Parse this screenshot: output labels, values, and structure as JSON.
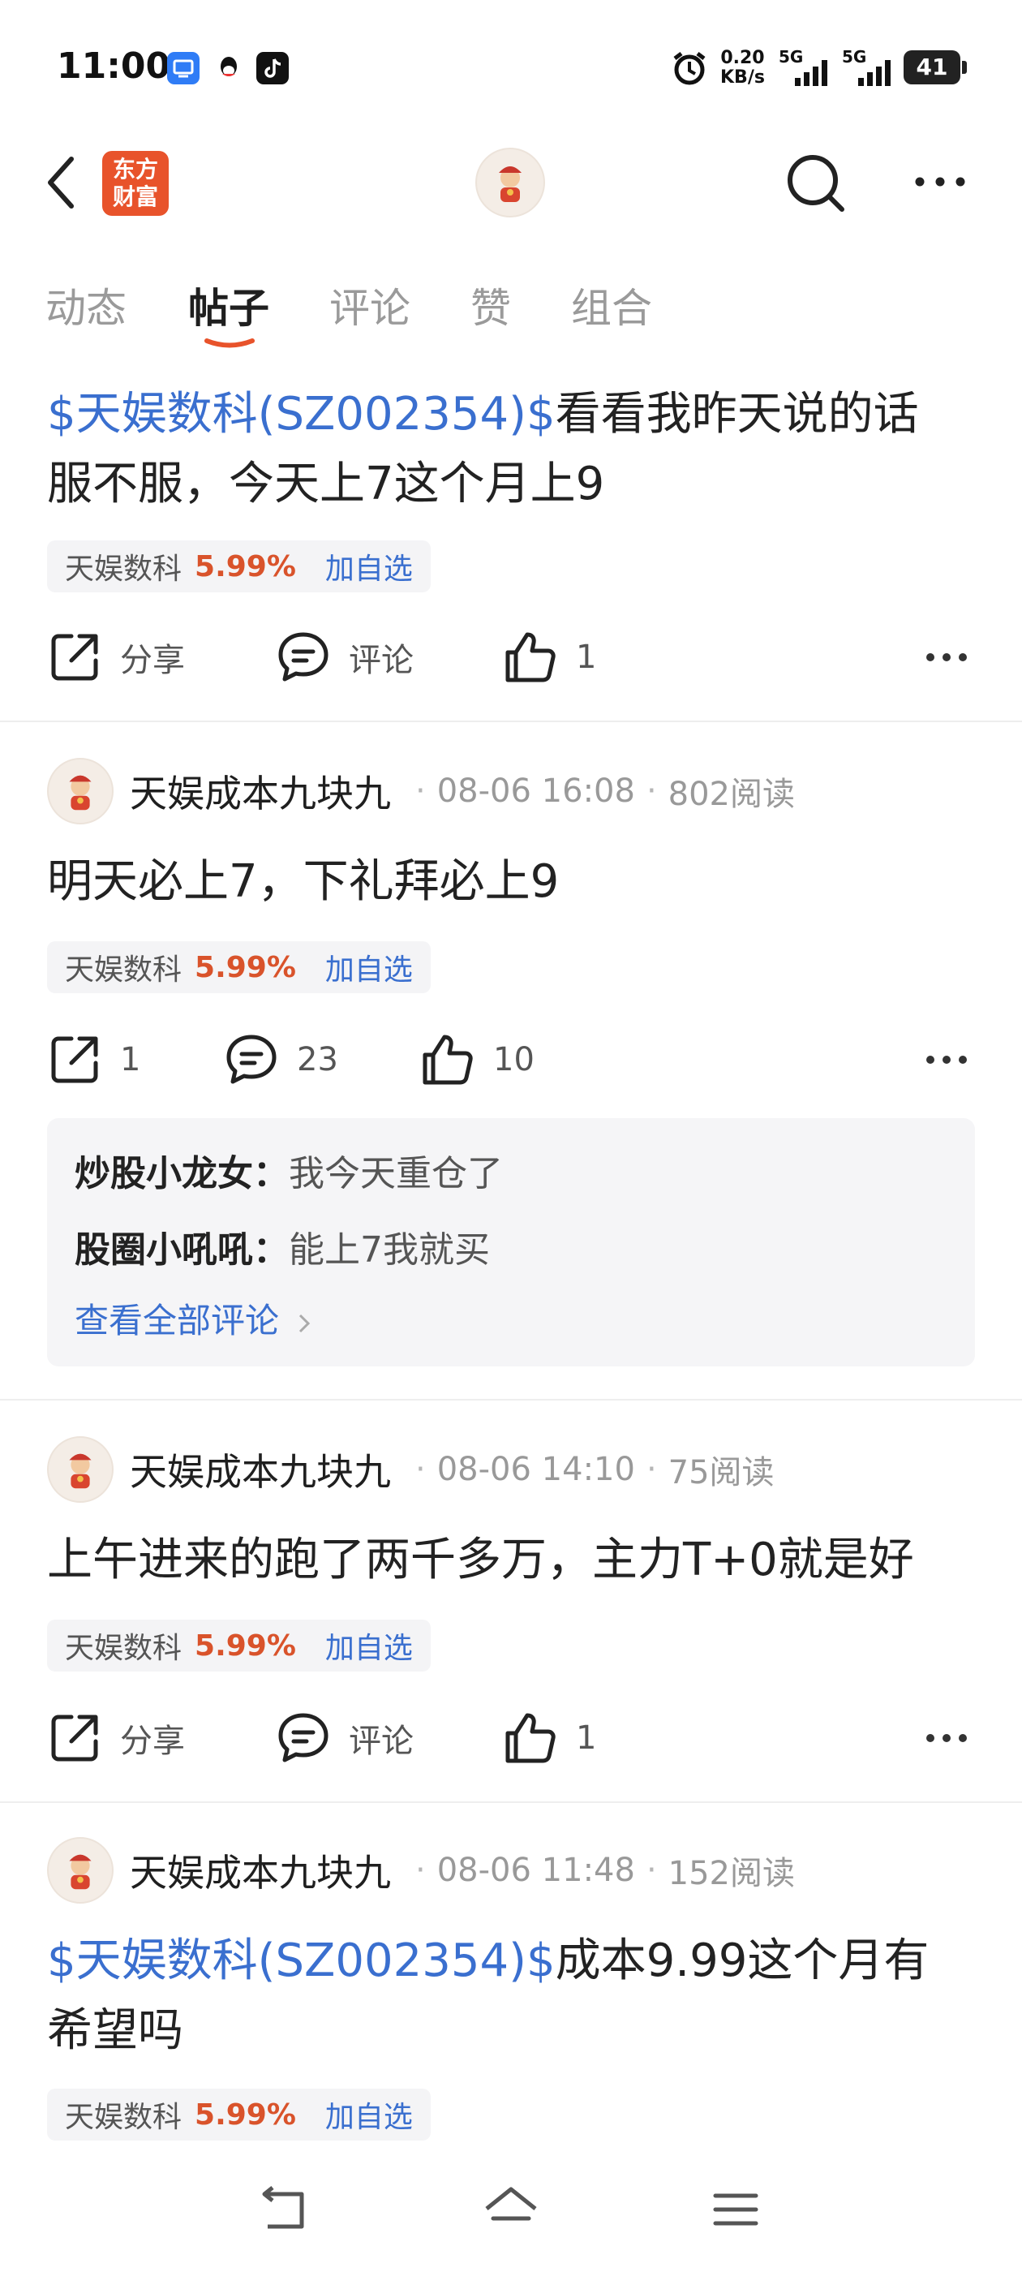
{
  "status_bar": {
    "time": "11:00",
    "net_speed_top": "0.20",
    "net_speed_bottom": "KB/s",
    "sig1": "5G",
    "sig2": "5G",
    "battery": "41"
  },
  "header": {
    "logo_text_1": "东方",
    "logo_text_2": "财富",
    "back_icon": "chevron-left-icon",
    "search_icon": "search-icon",
    "more_icon": "more-horizontal-icon"
  },
  "tabs": [
    {
      "label": "动态"
    },
    {
      "label": "帖子",
      "active": true
    },
    {
      "label": "评论"
    },
    {
      "label": "赞"
    },
    {
      "label": "组合"
    }
  ],
  "posts": [
    {
      "link": "$天娱数科(SZ002354)$",
      "text_line1": "看看我昨天说的话",
      "text_line2": "服不服，今天上7这个月上9",
      "stock": {
        "name": "天娱数科",
        "change": "5.99%",
        "add": "加自选"
      },
      "actions": {
        "share": "分享",
        "comment": "评论",
        "like": "1"
      }
    },
    {
      "author": "天娱成本九块九",
      "date": "08-06 16:08",
      "reads": "802阅读",
      "text": "明天必上7，下礼拜必上9",
      "stock": {
        "name": "天娱数科",
        "change": "5.99%",
        "add": "加自选"
      },
      "actions": {
        "share": "1",
        "comment": "23",
        "like": "10"
      },
      "comments": [
        {
          "user": "炒股小龙女：",
          "text": "我今天重仓了"
        },
        {
          "user": "股圈小吼吼：",
          "text": "能上7我就买"
        }
      ],
      "see_all": "查看全部评论"
    },
    {
      "author": "天娱成本九块九",
      "date": "08-06 14:10",
      "reads": "75阅读",
      "text": "上午进来的跑了两千多万，主力T+0就是好",
      "stock": {
        "name": "天娱数科",
        "change": "5.99%",
        "add": "加自选"
      },
      "actions": {
        "share": "分享",
        "comment": "评论",
        "like": "1"
      }
    },
    {
      "author": "天娱成本九块九",
      "date": "08-06 11:48",
      "reads": "152阅读",
      "link": "$天娱数科(SZ002354)$",
      "text_line1": "成本9.99这个月有",
      "text_line2": "希望吗",
      "stock": {
        "name": "天娱数科",
        "change": "5.99%",
        "add": "加自选"
      }
    }
  ],
  "colors": {
    "accent_blue": "#3a6fcf",
    "gain_red": "#d9532b",
    "logo_orange": "#e8532b",
    "tab_underline": "#e8532b"
  }
}
